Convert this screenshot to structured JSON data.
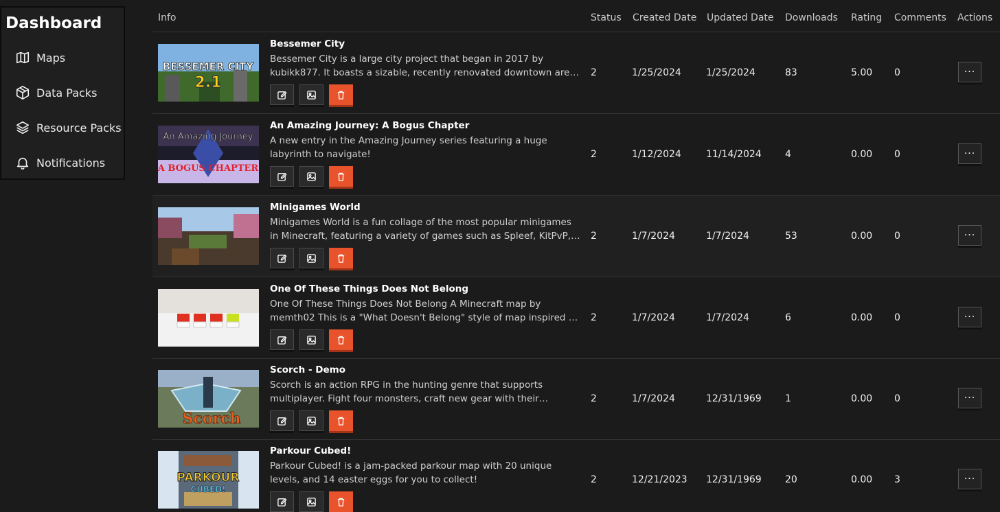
{
  "sidebar": {
    "title": "Dashboard",
    "items": [
      {
        "label": "Maps",
        "icon": "map-icon"
      },
      {
        "label": "Data Packs",
        "icon": "box-icon"
      },
      {
        "label": "Resource Packs",
        "icon": "layers-icon"
      },
      {
        "label": "Notifications",
        "icon": "bell-icon"
      }
    ]
  },
  "table": {
    "headers": [
      "Info",
      "Status",
      "Created Date",
      "Updated Date",
      "Downloads",
      "Rating",
      "Comments",
      "Actions"
    ],
    "rows": [
      {
        "title": "Bessemer City",
        "description": "Bessemer City is a large city project that began in 2017 by kubikk877. It boasts a sizable, recently renovated downtown area, a major river that i...",
        "status": "2",
        "created": "1/25/2024",
        "updated": "1/25/2024",
        "downloads": "83",
        "rating": "5.00",
        "comments": "0",
        "thumb_text": "BESSEMER CITY",
        "thumb_text2": "2.1"
      },
      {
        "title": "An Amazing Journey: A Bogus Chapter",
        "description": "A new entry in the Amazing Journey series featuring a huge labyrinth to navigate!",
        "status": "2",
        "created": "1/12/2024",
        "updated": "11/14/2024",
        "downloads": "4",
        "rating": "0.00",
        "comments": "0",
        "thumb_text": "An Amazing Journey",
        "thumb_text2": "A BOGUS CHAPTER"
      },
      {
        "title": "Minigames World",
        "description": "Minigames World is a fun collage of the most popular minigames in Minecraft, featuring a variety of games such as Spleef, KitPvP, Skywars,...",
        "status": "2",
        "created": "1/7/2024",
        "updated": "1/7/2024",
        "downloads": "53",
        "rating": "0.00",
        "comments": "0",
        "thumb_text": "",
        "thumb_text2": ""
      },
      {
        "title": "One Of These Things Does Not Belong",
        "description": "One Of These Things Does Not Belong A Minecraft map by memth02 This is a \"What Doesn't Belong\" style of map inspired by a lot of other \"What...",
        "status": "2",
        "created": "1/7/2024",
        "updated": "1/7/2024",
        "downloads": "6",
        "rating": "0.00",
        "comments": "0",
        "thumb_text": "",
        "thumb_text2": ""
      },
      {
        "title": "Scorch - Demo",
        "description": "Scorch is an action RPG in the hunting genre that supports multiplayer. Fight four monsters, craft new gear with their materials, and challenge...",
        "status": "2",
        "created": "1/7/2024",
        "updated": "12/31/1969",
        "downloads": "1",
        "rating": "0.00",
        "comments": "0",
        "thumb_text": "Scorch",
        "thumb_text2": ""
      },
      {
        "title": "Parkour Cubed!",
        "description": "Parkour Cubed! is a jam-packed parkour map with 20 unique levels, and 14 easter eggs for you to collect!",
        "status": "2",
        "created": "12/21/2023",
        "updated": "12/31/1969",
        "downloads": "20",
        "rating": "0.00",
        "comments": "3",
        "thumb_text": "PARKOUR",
        "thumb_text2": "CUBED!"
      }
    ],
    "more_label": "···"
  },
  "colors": {
    "background": "#1b1b1b",
    "delete": "#e8532b",
    "text": "#ffffff"
  }
}
